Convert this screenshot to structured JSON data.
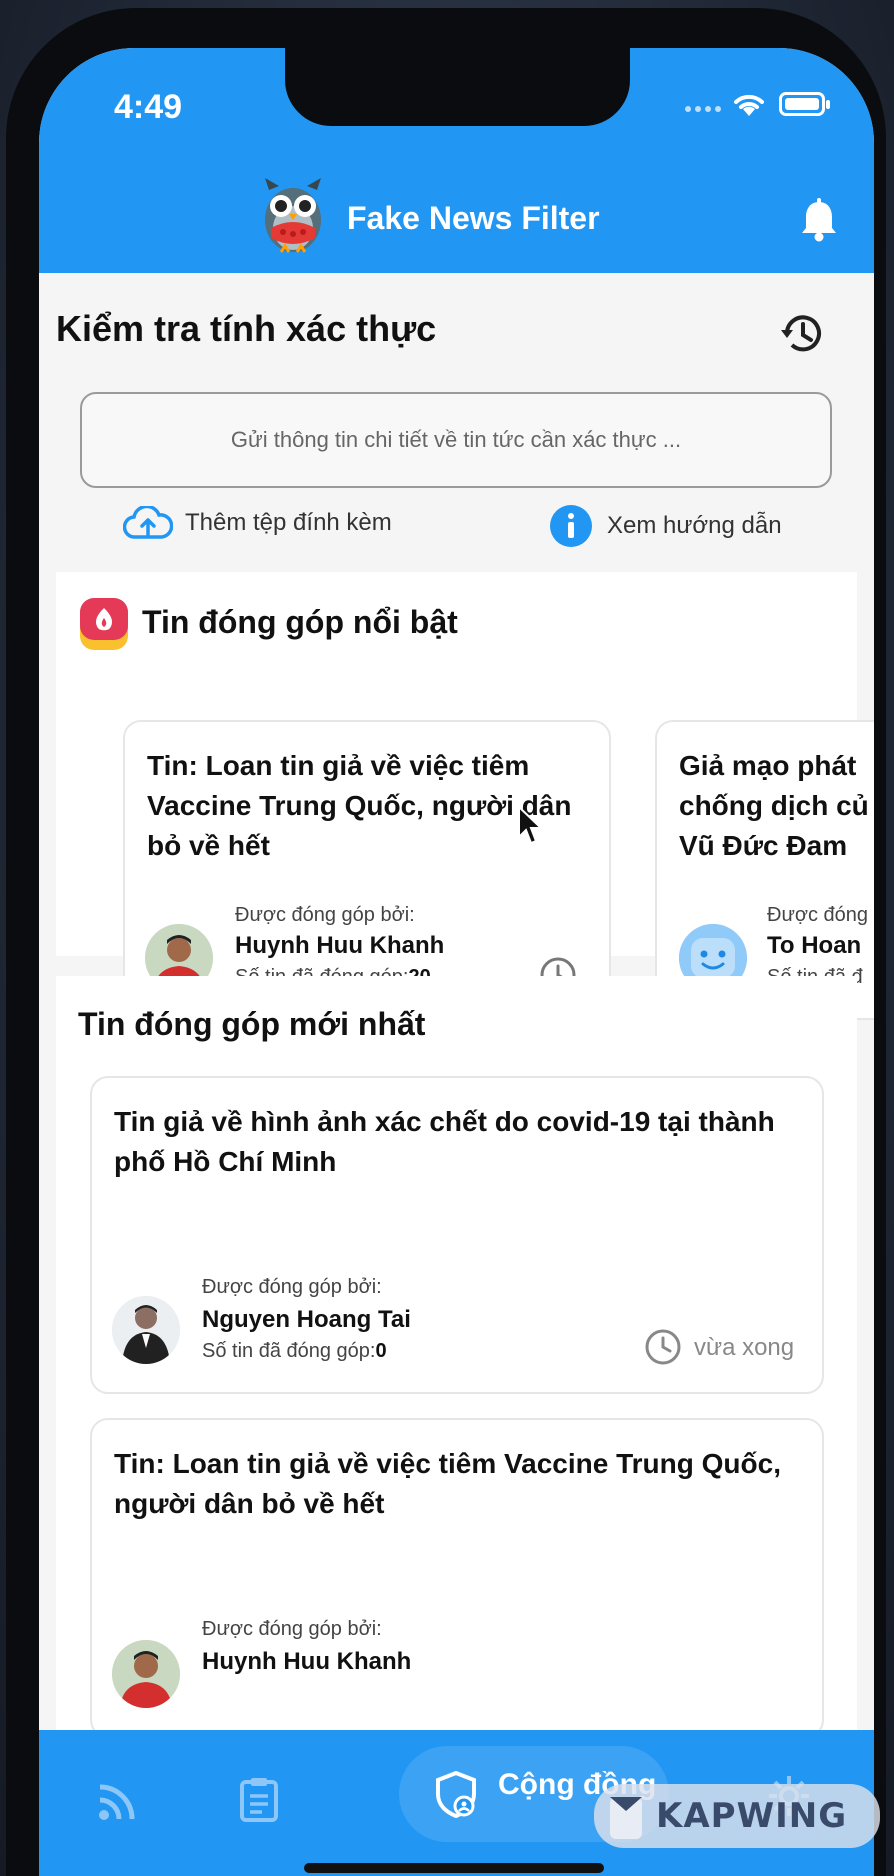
{
  "status_bar": {
    "time": "4:49"
  },
  "app": {
    "title": "Fake News Filter"
  },
  "verify": {
    "heading": "Kiểm tra tính xác thực",
    "input_placeholder": "Gửi thông tin chi tiết về tin tức cần xác thực ...",
    "attach_label": "Thêm tệp đính kèm",
    "guide_label": "Xem hướng dẫn"
  },
  "featured": {
    "heading": "Tin đóng góp nổi bật",
    "cards": [
      {
        "title": "Tin: Loan tin giả về việc tiêm Vaccine Trung Quốc, người dân bỏ về hết",
        "contrib_label": "Được đóng góp bởi:",
        "name": "Huynh Huu Khanh",
        "count_label": "Số tin đã đóng góp:",
        "count": "20"
      },
      {
        "title": "Giả mạo phát chống dịch củ Vũ Đức Đam",
        "contrib_label": "Được đóng",
        "name": "To Hoan",
        "count_label": "Số tin đã đ"
      }
    ]
  },
  "latest": {
    "heading": "Tin đóng góp mới nhất",
    "items": [
      {
        "title": "Tin giả về hình ảnh xác chết do covid-19 tại thành phố Hồ Chí Minh",
        "contrib_label": "Được đóng góp bởi:",
        "name": "Nguyen Hoang Tai",
        "count_label": "Số tin đã đóng góp:",
        "count": "0",
        "time": "vừa xong"
      },
      {
        "title": "Tin: Loan tin giả về việc tiêm Vaccine Trung Quốc, người dân bỏ về hết",
        "contrib_label": "Được đóng góp bởi:",
        "name": "Huynh Huu Khanh"
      }
    ]
  },
  "bottom_nav": {
    "items": [
      {
        "icon": "rss-icon"
      },
      {
        "icon": "clipboard-icon"
      },
      {
        "icon": "community-shield-icon",
        "label": "Cộng đồng"
      },
      {
        "icon": "settings-icon"
      }
    ]
  },
  "watermark": {
    "text": "KAPWING"
  },
  "colors": {
    "primary": "#2196f3",
    "background": "#f5f5f5"
  }
}
